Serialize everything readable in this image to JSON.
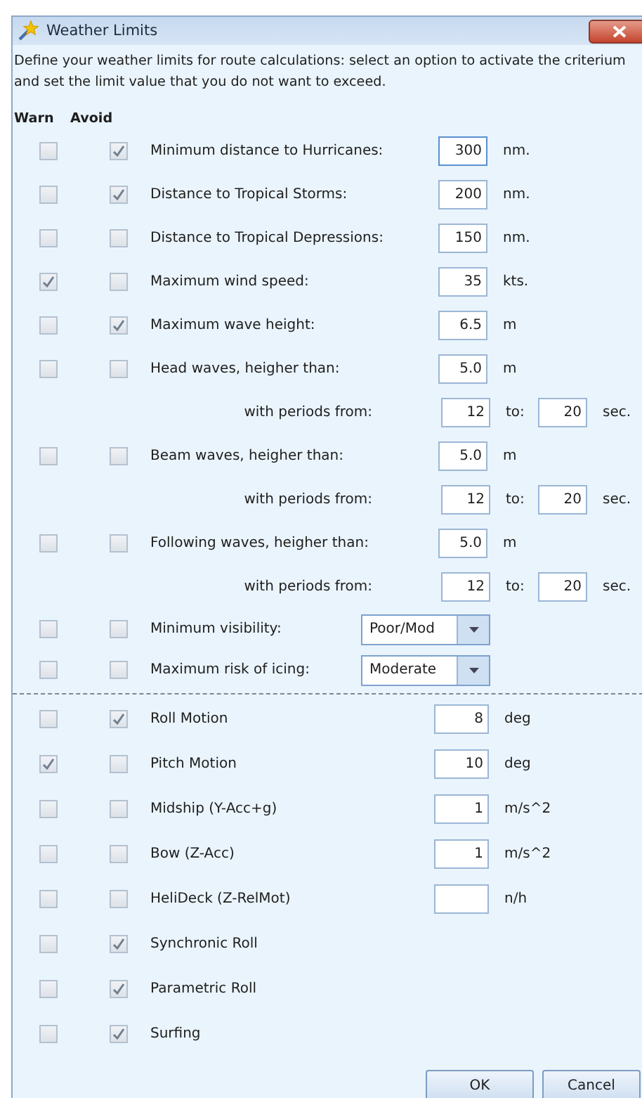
{
  "window": {
    "title": "Weather Limits"
  },
  "description": "Define your weather limits for route calculations: select an option to activate the criterium and set the limit value that you do not want to exceed.",
  "columns": [
    "Warn",
    "Avoid"
  ],
  "criteria": [
    {
      "kind": "value",
      "label": "Minimum distance to Hurricanes:",
      "warn": false,
      "avoid": true,
      "value": "300",
      "focused": true,
      "unit": "nm."
    },
    {
      "kind": "value",
      "label": "Distance to Tropical Storms:",
      "warn": false,
      "avoid": true,
      "value": "200",
      "focused": false,
      "unit": "nm."
    },
    {
      "kind": "value",
      "label": "Distance to Tropical Depressions:",
      "warn": false,
      "avoid": false,
      "value": "150",
      "focused": false,
      "unit": "nm."
    },
    {
      "kind": "value",
      "label": "Maximum wind speed:",
      "warn": true,
      "avoid": false,
      "value": "35",
      "focused": false,
      "unit": "kts."
    },
    {
      "kind": "value",
      "label": "Maximum wave height:",
      "warn": false,
      "avoid": true,
      "value": "6.5",
      "focused": false,
      "unit": "m"
    },
    {
      "kind": "value",
      "label": "Head waves, heigher than:",
      "warn": false,
      "avoid": false,
      "value": "5.0",
      "focused": false,
      "unit": "m"
    },
    {
      "kind": "periods",
      "label": "with periods from:",
      "from": "12",
      "to_label": "to:",
      "to": "20",
      "unit": "sec."
    },
    {
      "kind": "value",
      "label": "Beam waves, heigher than:",
      "warn": false,
      "avoid": false,
      "value": "5.0",
      "focused": false,
      "unit": "m"
    },
    {
      "kind": "periods",
      "label": "with periods from:",
      "from": "12",
      "to_label": "to:",
      "to": "20",
      "unit": "sec."
    },
    {
      "kind": "value",
      "label": "Following waves, heigher than:",
      "warn": false,
      "avoid": false,
      "value": "5.0",
      "focused": false,
      "unit": "m"
    },
    {
      "kind": "periods",
      "label": "with periods from:",
      "from": "12",
      "to_label": "to:",
      "to": "20",
      "unit": "sec."
    },
    {
      "kind": "select",
      "label": "Minimum visibility:",
      "warn": false,
      "avoid": false,
      "value": "Poor/Mod"
    },
    {
      "kind": "select",
      "label": "Maximum risk of icing:",
      "warn": false,
      "avoid": false,
      "value": "Moderate"
    }
  ],
  "motions": [
    {
      "kind": "value",
      "label": "Roll Motion",
      "warn": false,
      "avoid": true,
      "value": "8",
      "unit": "deg"
    },
    {
      "kind": "value",
      "label": "Pitch Motion",
      "warn": true,
      "avoid": false,
      "value": "10",
      "unit": "deg"
    },
    {
      "kind": "value",
      "label": "Midship (Y-Acc+g)",
      "warn": false,
      "avoid": false,
      "value": "1",
      "unit": "m/s^2"
    },
    {
      "kind": "value",
      "label": "Bow (Z-Acc)",
      "warn": false,
      "avoid": false,
      "value": "1",
      "unit": "m/s^2"
    },
    {
      "kind": "value",
      "label": "HeliDeck (Z-RelMot)",
      "warn": false,
      "avoid": false,
      "unit": "n/h"
    },
    {
      "kind": "check",
      "label": "Synchronic Roll",
      "warn": false,
      "avoid": true
    },
    {
      "kind": "check",
      "label": "Parametric Roll",
      "warn": false,
      "avoid": true
    },
    {
      "kind": "check",
      "label": "Surfing",
      "warn": false,
      "avoid": true
    }
  ],
  "buttons": [
    "OK",
    "Cancel"
  ]
}
